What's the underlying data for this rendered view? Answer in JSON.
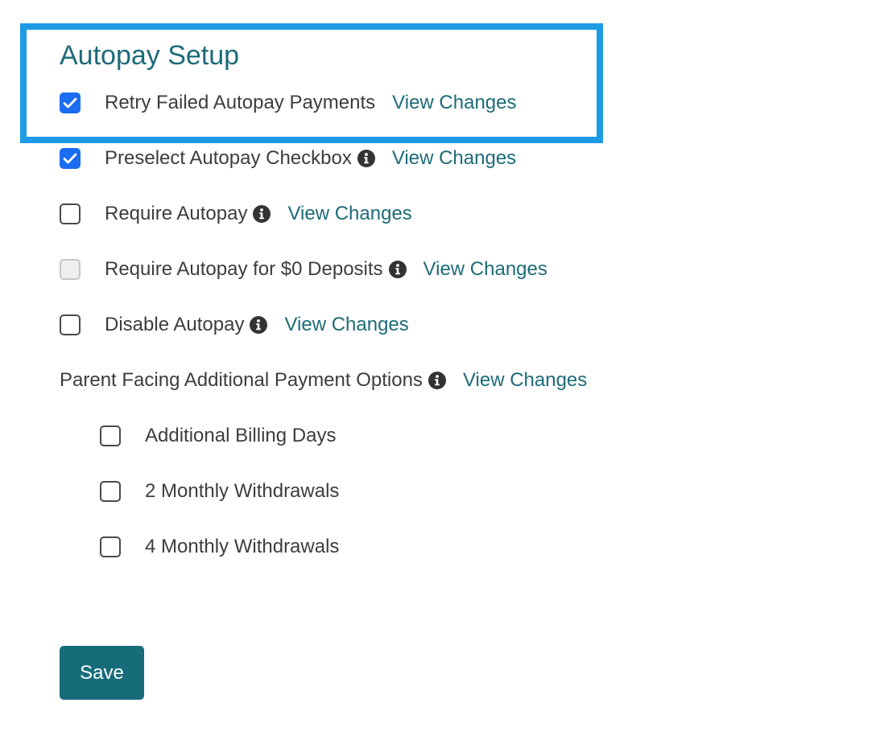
{
  "section": {
    "title": "Autopay Setup"
  },
  "options": [
    {
      "label": "Retry Failed Autopay Payments",
      "checked": true,
      "disabled": false,
      "info": false,
      "link": "View Changes"
    },
    {
      "label": "Preselect Autopay Checkbox",
      "checked": true,
      "disabled": false,
      "info": true,
      "link": "View Changes"
    },
    {
      "label": "Require Autopay",
      "checked": false,
      "disabled": false,
      "info": true,
      "link": "View Changes"
    },
    {
      "label": "Require Autopay for $0 Deposits",
      "checked": false,
      "disabled": true,
      "info": true,
      "link": "View Changes"
    },
    {
      "label": "Disable Autopay",
      "checked": false,
      "disabled": false,
      "info": true,
      "link": "View Changes"
    }
  ],
  "additional": {
    "label": "Parent Facing Additional Payment Options",
    "link": "View Changes",
    "items": [
      {
        "label": "Additional Billing Days",
        "checked": false
      },
      {
        "label": "2 Monthly Withdrawals",
        "checked": false
      },
      {
        "label": "4 Monthly Withdrawals",
        "checked": false
      }
    ]
  },
  "actions": {
    "save_label": "Save"
  },
  "colors": {
    "accent": "#1d6b78",
    "highlight": "#1e9be5",
    "checkbox_checked": "#1a6cf0",
    "button": "#176c7a"
  }
}
